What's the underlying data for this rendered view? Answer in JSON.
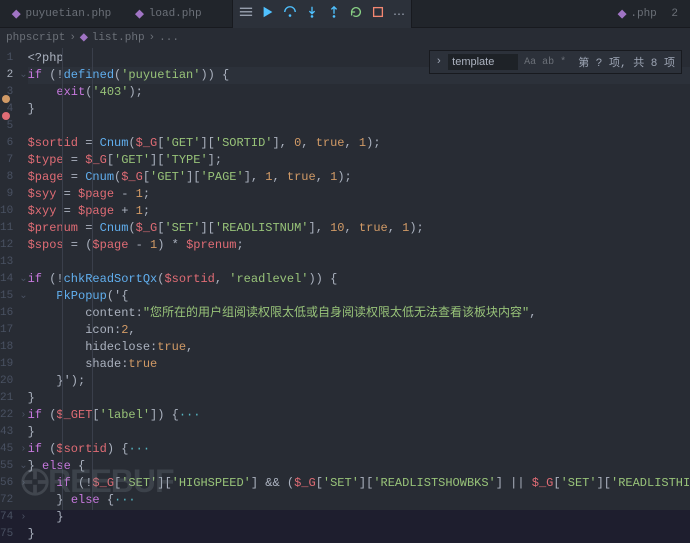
{
  "tabs": [
    {
      "icon": "php",
      "name": "puyuetian.php",
      "active": false
    },
    {
      "icon": "php",
      "name": "load.php",
      "active": false
    }
  ],
  "rightTab": {
    "name": ".php",
    "badge": "2"
  },
  "breadcrumbs": [
    "phpscript",
    "list.php",
    "..."
  ],
  "find": {
    "value": "template",
    "opts": [
      "Aa",
      "ab",
      "*"
    ],
    "status": "第 ? 项, 共 8 项"
  },
  "gutter": [
    "1",
    "2",
    "3",
    "4",
    "5",
    "6",
    "7",
    "8",
    "9",
    "10",
    "11",
    "12",
    "13",
    "14",
    "15",
    "16",
    "17",
    "18",
    "19",
    "20",
    "21",
    "22",
    "43",
    "45",
    "55",
    "56",
    "72",
    "74",
    "75"
  ],
  "currentLine": 1,
  "fold": [
    "",
    "v",
    "",
    "",
    "",
    "",
    "",
    "",
    "",
    "",
    "",
    "",
    "",
    "v",
    "v",
    "",
    "",
    "",
    "",
    "",
    "",
    ">",
    "",
    ">",
    "v",
    ">",
    "",
    ">",
    ""
  ],
  "code": [
    [
      {
        "c": "p",
        "t": "<?php"
      }
    ],
    [
      {
        "c": "k",
        "t": "if"
      },
      {
        "c": "p",
        "t": " (!"
      },
      {
        "c": "f2",
        "t": "defined"
      },
      {
        "c": "p",
        "t": "("
      },
      {
        "c": "s",
        "t": "'puyuetian'"
      },
      {
        "c": "p",
        "t": ")) {"
      }
    ],
    [
      {
        "c": "p",
        "t": "    "
      },
      {
        "c": "k",
        "t": "exit"
      },
      {
        "c": "p",
        "t": "("
      },
      {
        "c": "s",
        "t": "'403'"
      },
      {
        "c": "p",
        "t": ");"
      }
    ],
    [
      {
        "c": "p",
        "t": "}"
      }
    ],
    [],
    [
      {
        "c": "v",
        "t": "$sortid"
      },
      {
        "c": "p",
        "t": " = "
      },
      {
        "c": "f2",
        "t": "Cnum"
      },
      {
        "c": "p",
        "t": "("
      },
      {
        "c": "v",
        "t": "$_G"
      },
      {
        "c": "p",
        "t": "["
      },
      {
        "c": "s",
        "t": "'GET'"
      },
      {
        "c": "p",
        "t": "]["
      },
      {
        "c": "s",
        "t": "'SORTID'"
      },
      {
        "c": "p",
        "t": "], "
      },
      {
        "c": "n",
        "t": "0"
      },
      {
        "c": "p",
        "t": ", "
      },
      {
        "c": "n",
        "t": "true"
      },
      {
        "c": "p",
        "t": ", "
      },
      {
        "c": "n",
        "t": "1"
      },
      {
        "c": "p",
        "t": ");"
      }
    ],
    [
      {
        "c": "v",
        "t": "$type"
      },
      {
        "c": "p",
        "t": " = "
      },
      {
        "c": "v",
        "t": "$_G"
      },
      {
        "c": "p",
        "t": "["
      },
      {
        "c": "s",
        "t": "'GET'"
      },
      {
        "c": "p",
        "t": "]["
      },
      {
        "c": "s",
        "t": "'TYPE'"
      },
      {
        "c": "p",
        "t": "];"
      }
    ],
    [
      {
        "c": "v",
        "t": "$page"
      },
      {
        "c": "p",
        "t": " = "
      },
      {
        "c": "f2",
        "t": "Cnum"
      },
      {
        "c": "p",
        "t": "("
      },
      {
        "c": "v",
        "t": "$_G"
      },
      {
        "c": "p",
        "t": "["
      },
      {
        "c": "s",
        "t": "'GET'"
      },
      {
        "c": "p",
        "t": "]["
      },
      {
        "c": "s",
        "t": "'PAGE'"
      },
      {
        "c": "p",
        "t": "], "
      },
      {
        "c": "n",
        "t": "1"
      },
      {
        "c": "p",
        "t": ", "
      },
      {
        "c": "n",
        "t": "true"
      },
      {
        "c": "p",
        "t": ", "
      },
      {
        "c": "n",
        "t": "1"
      },
      {
        "c": "p",
        "t": ");"
      }
    ],
    [
      {
        "c": "v",
        "t": "$syy"
      },
      {
        "c": "p",
        "t": " = "
      },
      {
        "c": "v",
        "t": "$page"
      },
      {
        "c": "p",
        "t": " - "
      },
      {
        "c": "n",
        "t": "1"
      },
      {
        "c": "p",
        "t": ";"
      }
    ],
    [
      {
        "c": "v",
        "t": "$xyy"
      },
      {
        "c": "p",
        "t": " = "
      },
      {
        "c": "v",
        "t": "$page"
      },
      {
        "c": "p",
        "t": " + "
      },
      {
        "c": "n",
        "t": "1"
      },
      {
        "c": "p",
        "t": ";"
      }
    ],
    [
      {
        "c": "v",
        "t": "$prenum"
      },
      {
        "c": "p",
        "t": " = "
      },
      {
        "c": "f2",
        "t": "Cnum"
      },
      {
        "c": "p",
        "t": "("
      },
      {
        "c": "v",
        "t": "$_G"
      },
      {
        "c": "p",
        "t": "["
      },
      {
        "c": "s",
        "t": "'SET'"
      },
      {
        "c": "p",
        "t": "]["
      },
      {
        "c": "s",
        "t": "'READLISTNUM'"
      },
      {
        "c": "p",
        "t": "], "
      },
      {
        "c": "n",
        "t": "10"
      },
      {
        "c": "p",
        "t": ", "
      },
      {
        "c": "n",
        "t": "true"
      },
      {
        "c": "p",
        "t": ", "
      },
      {
        "c": "n",
        "t": "1"
      },
      {
        "c": "p",
        "t": ");"
      }
    ],
    [
      {
        "c": "v",
        "t": "$spos"
      },
      {
        "c": "p",
        "t": " = ("
      },
      {
        "c": "v",
        "t": "$page"
      },
      {
        "c": "p",
        "t": " - "
      },
      {
        "c": "n",
        "t": "1"
      },
      {
        "c": "p",
        "t": ") * "
      },
      {
        "c": "v",
        "t": "$prenum"
      },
      {
        "c": "p",
        "t": ";"
      }
    ],
    [],
    [
      {
        "c": "k",
        "t": "if"
      },
      {
        "c": "p",
        "t": " (!"
      },
      {
        "c": "f2",
        "t": "chkReadSortQx"
      },
      {
        "c": "p",
        "t": "("
      },
      {
        "c": "v",
        "t": "$sortid"
      },
      {
        "c": "p",
        "t": ", "
      },
      {
        "c": "s",
        "t": "'readlevel'"
      },
      {
        "c": "p",
        "t": ")) {"
      }
    ],
    [
      {
        "c": "p",
        "t": "    "
      },
      {
        "c": "f2",
        "t": "PkPopup"
      },
      {
        "c": "p",
        "t": "('{"
      }
    ],
    [
      {
        "c": "p",
        "t": "        content:"
      },
      {
        "c": "s",
        "t": "\"您所在的用户组阅读权限太低或自身阅读权限太低无法查看该板块内容\""
      },
      {
        "c": "p",
        "t": ","
      }
    ],
    [
      {
        "c": "p",
        "t": "        icon:"
      },
      {
        "c": "n",
        "t": "2"
      },
      {
        "c": "p",
        "t": ","
      }
    ],
    [
      {
        "c": "p",
        "t": "        hideclose:"
      },
      {
        "c": "n",
        "t": "true"
      },
      {
        "c": "p",
        "t": ","
      }
    ],
    [
      {
        "c": "p",
        "t": "        shade:"
      },
      {
        "c": "n",
        "t": "true"
      }
    ],
    [
      {
        "c": "p",
        "t": "    }');"
      }
    ],
    [
      {
        "c": "p",
        "t": "}"
      }
    ],
    [
      {
        "c": "k",
        "t": "if"
      },
      {
        "c": "p",
        "t": " ("
      },
      {
        "c": "v",
        "t": "$_GET"
      },
      {
        "c": "p",
        "t": "["
      },
      {
        "c": "s",
        "t": "'label'"
      },
      {
        "c": "p",
        "t": "]) {"
      },
      {
        "c": "o",
        "t": "···"
      }
    ],
    [
      {
        "c": "p",
        "t": "}"
      }
    ],
    [
      {
        "c": "k",
        "t": "if"
      },
      {
        "c": "p",
        "t": " ("
      },
      {
        "c": "v",
        "t": "$sortid"
      },
      {
        "c": "p",
        "t": ") {"
      },
      {
        "c": "o",
        "t": "···"
      }
    ],
    [
      {
        "c": "p",
        "t": "} "
      },
      {
        "c": "k",
        "t": "else"
      },
      {
        "c": "p",
        "t": " {"
      }
    ],
    [
      {
        "c": "p",
        "t": "    "
      },
      {
        "c": "k",
        "t": "if"
      },
      {
        "c": "p",
        "t": " (!"
      },
      {
        "c": "v",
        "t": "$_G"
      },
      {
        "c": "p",
        "t": "["
      },
      {
        "c": "s",
        "t": "'SET'"
      },
      {
        "c": "p",
        "t": "]["
      },
      {
        "c": "s",
        "t": "'HIGHSPEED'"
      },
      {
        "c": "p",
        "t": "] && ("
      },
      {
        "c": "v",
        "t": "$_G"
      },
      {
        "c": "p",
        "t": "["
      },
      {
        "c": "s",
        "t": "'SET'"
      },
      {
        "c": "p",
        "t": "]["
      },
      {
        "c": "s",
        "t": "'READLISTSHOWBKS'"
      },
      {
        "c": "p",
        "t": "] || "
      },
      {
        "c": "v",
        "t": "$_G"
      },
      {
        "c": "p",
        "t": "["
      },
      {
        "c": "s",
        "t": "'SET'"
      },
      {
        "c": "p",
        "t": "]["
      },
      {
        "c": "s",
        "t": "'READLISTHIDDENBKS'"
      },
      {
        "c": "p",
        "t": "])) {"
      },
      {
        "c": "o",
        "t": "···"
      }
    ],
    [
      {
        "c": "p",
        "t": "    } "
      },
      {
        "c": "k",
        "t": "else"
      },
      {
        "c": "p",
        "t": " {"
      },
      {
        "c": "o",
        "t": "···"
      }
    ],
    [
      {
        "c": "p",
        "t": "    }"
      }
    ],
    [
      {
        "c": "p",
        "t": "}"
      }
    ]
  ],
  "watermark": "REEBUF"
}
